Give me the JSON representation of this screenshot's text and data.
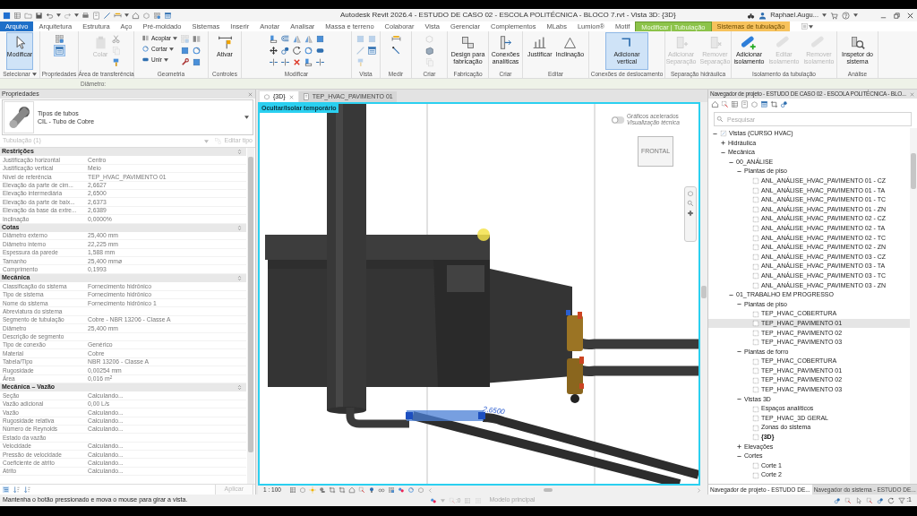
{
  "window": {
    "title": "Autodesk Revit 2026.4 - ESTUDO DE CASO 02 - ESCOLA POLITÉCNICA - BLOCO 7.rvt - Vista 3D: {3D}",
    "user": "Raphael.Augu..."
  },
  "ribbon_tabs": [
    {
      "label": "Arquivo",
      "kind": "file",
      "selected": false
    },
    {
      "label": "Arquitetura",
      "kind": "normal",
      "selected": false
    },
    {
      "label": "Estrutura",
      "kind": "normal",
      "selected": false
    },
    {
      "label": "Aço",
      "kind": "normal",
      "selected": false
    },
    {
      "label": "Pré-moldado",
      "kind": "normal",
      "selected": false
    },
    {
      "label": "Sistemas",
      "kind": "normal",
      "selected": false
    },
    {
      "label": "Inserir",
      "kind": "normal",
      "selected": false
    },
    {
      "label": "Anotar",
      "kind": "normal",
      "selected": false
    },
    {
      "label": "Analisar",
      "kind": "normal",
      "selected": false
    },
    {
      "label": "Massa e terreno",
      "kind": "normal",
      "selected": false
    },
    {
      "label": "Colaborar",
      "kind": "normal",
      "selected": false
    },
    {
      "label": "Vista",
      "kind": "normal",
      "selected": false
    },
    {
      "label": "Gerenciar",
      "kind": "normal",
      "selected": false
    },
    {
      "label": "Complementos",
      "kind": "normal",
      "selected": false
    },
    {
      "label": "MLabs",
      "kind": "normal",
      "selected": false
    },
    {
      "label": "Lumion®",
      "kind": "normal",
      "selected": false
    },
    {
      "label": "Motif",
      "kind": "normal",
      "selected": false
    },
    {
      "label": "Modificar | Tubulação",
      "kind": "contextual",
      "color": "#8cc34a",
      "selected": true
    },
    {
      "label": "Sistemas de tubulação",
      "kind": "contextual",
      "color": "#f7c25c",
      "selected": false
    }
  ],
  "ribbon_panels": [
    {
      "label": "Selecionar",
      "dropdown": true,
      "tools": [
        {
          "kind": "large",
          "label": "Modificar",
          "selected": true,
          "disabled": false
        }
      ]
    },
    {
      "label": "Propriedades",
      "dropdown": false,
      "tools": [
        {
          "kind": "icon",
          "selected": false,
          "disabled": false
        },
        {
          "kind": "icon",
          "selected": true,
          "disabled": false
        }
      ]
    },
    {
      "label": "Área de transferência",
      "dropdown": false,
      "tools": [
        {
          "kind": "large",
          "label": "Colar",
          "selected": false,
          "disabled": true
        },
        {
          "kind": "icon",
          "selected": false,
          "disabled": false
        },
        {
          "kind": "icon",
          "selected": false,
          "disabled": true
        },
        {
          "kind": "icon",
          "selected": false,
          "disabled": false
        }
      ]
    },
    {
      "label": "Geometria",
      "dropdown": false,
      "tools": [
        {
          "kind": "small",
          "label": "Acoplar",
          "dropdown": true,
          "selected": false,
          "disabled": false
        },
        {
          "kind": "small",
          "label": "Cortar",
          "dropdown": true,
          "selected": false,
          "disabled": false
        },
        {
          "kind": "small",
          "label": "Unir",
          "dropdown": true,
          "selected": false,
          "disabled": false
        },
        {
          "kind": "icon",
          "selected": false,
          "disabled": true
        },
        {
          "kind": "icon",
          "selected": false,
          "disabled": false
        },
        {
          "kind": "icon",
          "selected": false,
          "disabled": false
        },
        {
          "kind": "icon",
          "selected": false,
          "disabled": false
        },
        {
          "kind": "icon",
          "selected": false,
          "disabled": false
        },
        {
          "kind": "icon",
          "selected": false,
          "disabled": false
        }
      ]
    },
    {
      "label": "Controles",
      "dropdown": false,
      "tools": [
        {
          "kind": "large",
          "label": "Ativar",
          "selected": false,
          "disabled": false
        }
      ]
    },
    {
      "label": "Modificar",
      "dropdown": false,
      "tools": [
        {
          "kind": "icon",
          "selected": false,
          "disabled": false
        },
        {
          "kind": "icon",
          "selected": false,
          "disabled": false
        },
        {
          "kind": "icon",
          "selected": false,
          "disabled": false
        },
        {
          "kind": "icon",
          "selected": false,
          "disabled": false
        },
        {
          "kind": "icon",
          "selected": false,
          "disabled": false
        },
        {
          "kind": "icon",
          "selected": false,
          "disabled": false
        },
        {
          "kind": "icon",
          "selected": false,
          "disabled": false
        },
        {
          "kind": "icon",
          "selected": false,
          "disabled": false
        },
        {
          "kind": "icon",
          "selected": false,
          "disabled": false
        },
        {
          "kind": "icon",
          "selected": false,
          "disabled": false
        },
        {
          "kind": "icon",
          "selected": false,
          "disabled": false
        },
        {
          "kind": "icon",
          "selected": false,
          "disabled": false
        },
        {
          "kind": "icon",
          "selected": false,
          "disabled": false
        },
        {
          "kind": "icon",
          "selected": false,
          "disabled": false
        },
        {
          "kind": "icon",
          "selected": false,
          "disabled": false
        }
      ]
    },
    {
      "label": "Vista",
      "dropdown": false,
      "tools": [
        {
          "kind": "icon",
          "selected": false,
          "disabled": true
        },
        {
          "kind": "icon",
          "selected": false,
          "disabled": true
        },
        {
          "kind": "icon",
          "selected": false,
          "disabled": true
        },
        {
          "kind": "icon",
          "selected": false,
          "disabled": true
        },
        {
          "kind": "icon",
          "selected": false,
          "disabled": false
        }
      ]
    },
    {
      "label": "Medir",
      "dropdown": false,
      "tools": [
        {
          "kind": "icon",
          "selected": false,
          "disabled": false
        },
        {
          "kind": "icon",
          "selected": false,
          "disabled": false
        }
      ]
    },
    {
      "label": "Criar",
      "dropdown": false,
      "tools": [
        {
          "kind": "icon",
          "selected": false,
          "disabled": true
        },
        {
          "kind": "icon",
          "selected": false,
          "disabled": false
        },
        {
          "kind": "icon",
          "selected": false,
          "disabled": true
        }
      ]
    },
    {
      "label": "Fabricação",
      "dropdown": false,
      "tools": [
        {
          "kind": "large",
          "label": "Design para fabricação",
          "selected": false,
          "disabled": false
        }
      ]
    },
    {
      "label": "Criar",
      "dropdown": false,
      "tools": [
        {
          "kind": "large",
          "label": "Conexões analíticas",
          "selected": false,
          "disabled": false
        }
      ]
    },
    {
      "label": "Editar",
      "dropdown": false,
      "tools": [
        {
          "kind": "large",
          "label": "Justificar",
          "selected": false,
          "disabled": false
        },
        {
          "kind": "large",
          "label": "Inclinação",
          "selected": false,
          "disabled": false
        }
      ]
    },
    {
      "label": "Conexões de deslocamento",
      "dropdown": false,
      "tools": [
        {
          "kind": "large",
          "label": "Adicionar vertical",
          "selected": true,
          "disabled": false
        }
      ]
    },
    {
      "label": "Separação hidráulica",
      "dropdown": false,
      "tools": [
        {
          "kind": "large",
          "label": "Adicionar Separação",
          "selected": false,
          "disabled": true
        },
        {
          "kind": "large",
          "label": "Remover Separação",
          "selected": false,
          "disabled": true
        }
      ]
    },
    {
      "label": "Isolamento da tubulação",
      "dropdown": false,
      "tools": [
        {
          "kind": "large",
          "label": "Adicionar isolamento",
          "selected": false,
          "disabled": false
        },
        {
          "kind": "large",
          "label": "Editar isolamento",
          "selected": false,
          "disabled": true
        },
        {
          "kind": "large",
          "label": "Remover isolamento",
          "selected": false,
          "disabled": true
        }
      ]
    },
    {
      "label": "Análise",
      "dropdown": false,
      "tools": [
        {
          "kind": "large",
          "label": "Inspetor do sistema",
          "selected": false,
          "disabled": false
        }
      ]
    }
  ],
  "options_bar": {
    "label": "Diâmetro:"
  },
  "properties": {
    "title": "Propriedades",
    "type_family": "Tipos de tubos",
    "type_name": "CIL - Tubo de Cobre",
    "filter": {
      "label": "Tubulação (1)",
      "disabled": true
    },
    "edit_type": {
      "label": "Editar tipo",
      "disabled": true
    },
    "groups": [
      {
        "name": "Restrições",
        "rows": [
          {
            "label": "Justificação horizontal",
            "value": "Centro"
          },
          {
            "label": "Justificação vertical",
            "value": "Meio"
          },
          {
            "label": "Nível de referência",
            "value": "TEP_HVAC_PAVIMENTO 01"
          },
          {
            "label": "Elevação da parte de cim...",
            "value": "2,6627"
          },
          {
            "label": "Elevação intermediária",
            "value": "2,6500"
          },
          {
            "label": "Elevação da parte de baix...",
            "value": "2,6373"
          },
          {
            "label": "Elevação da base da extre...",
            "value": "2,6389"
          },
          {
            "label": "Inclinação",
            "value": "0,0000%"
          }
        ]
      },
      {
        "name": "Cotas",
        "rows": [
          {
            "label": "Diâmetro externo",
            "value": "25,400 mm"
          },
          {
            "label": "Diâmetro interno",
            "value": "22,225 mm"
          },
          {
            "label": "Espessura da parede",
            "value": "1,588 mm"
          },
          {
            "label": "Tamanho",
            "value": "25,400 mmø"
          },
          {
            "label": "Comprimento",
            "value": "0,1993"
          }
        ]
      },
      {
        "name": "Mecânica",
        "rows": [
          {
            "label": "Classificação do sistema",
            "value": "Fornecimento hidrônico"
          },
          {
            "label": "Tipo de sistema",
            "value": "Fornecimento hidrônico"
          },
          {
            "label": "Nome do sistema",
            "value": "Fornecimento hidrônico 1"
          },
          {
            "label": "Abreviatura do sistema"
          },
          {
            "label": "Segmento de tubulação",
            "value": "Cobre - NBR 13206 - Classe A"
          },
          {
            "label": "Diâmetro",
            "value": "25,400 mm"
          },
          {
            "label": "Descrição de segmento"
          },
          {
            "label": "Tipo de conexão",
            "value": "Genérico"
          },
          {
            "label": "Material",
            "value": "Cobre"
          },
          {
            "label": "Tabela/Tipo",
            "value": "NBR 13206 - Classe A"
          },
          {
            "label": "Rugosidade",
            "value": "0,00254 mm"
          },
          {
            "label": "Área",
            "value": "0,016 m$^{2}$"
          }
        ]
      },
      {
        "name": "Mecânica – Vazão",
        "rows": [
          {
            "label": "Seção",
            "value": "Calculando..."
          },
          {
            "label": "Vazão adicional",
            "value": "0,00 L/s"
          },
          {
            "label": "Vazão",
            "value": "Calculando..."
          },
          {
            "label": "Rugosidade relativa",
            "value": "Calculando..."
          },
          {
            "label": "Número de Reynolds",
            "value": "Calculando..."
          },
          {
            "label": "Estado da vazão"
          },
          {
            "label": "Velocidade",
            "value": "Calculando..."
          },
          {
            "label": "Pressão de velocidade",
            "value": "Calculando..."
          },
          {
            "label": "Coeficiente de atrito",
            "value": "Calculando..."
          },
          {
            "label": "Atrito",
            "value": "Calculando..."
          }
        ]
      }
    ],
    "apply": {
      "label": "Aplicar",
      "disabled": true
    }
  },
  "view_tabs": [
    {
      "label": "{3D}",
      "selected": true
    },
    {
      "label": "TEP_HVAC_PAVIMENTO 01",
      "selected": false
    }
  ],
  "viewport": {
    "banner": "Ocultar/Isolar temporário",
    "graphics_toggle": {
      "label": "Gráficos acelerados",
      "sublabel": "Visualização técnica",
      "on": false
    },
    "viewcube_face": "FRONTAL",
    "dimension": "2,6500"
  },
  "view_control_bar": {
    "scale": "1 : 100"
  },
  "project_browser": {
    "title": "Navegador de projeto - ESTUDO DE CASO 02 - ESCOLA POLITÉCNICA - BLO...",
    "search": {
      "placeholder": "Pesquisar"
    },
    "tree": [
      {
        "label": "Vistas (CURSO HVAC)",
        "kind": "root",
        "expanded": true,
        "children": [
          {
            "label": "Hidráulica",
            "kind": "folder",
            "expanded": false
          },
          {
            "label": "Mecânica",
            "kind": "folder",
            "expanded": true,
            "children": [
              {
                "label": "00_ANÁLISE",
                "kind": "folder",
                "expanded": true,
                "children": [
                  {
                    "label": "Plantas de piso",
                    "kind": "folder",
                    "expanded": true,
                    "children": [
                      {
                        "label": "ANL_ANÁLISE_HVAC_PAVIMENTO 01 - CZ",
                        "kind": "view",
                        "selected": false
                      },
                      {
                        "label": "ANL_ANÁLISE_HVAC_PAVIMENTO 01 - TA",
                        "kind": "view",
                        "selected": false
                      },
                      {
                        "label": "ANL_ANÁLISE_HVAC_PAVIMENTO 01 - TC",
                        "kind": "view",
                        "selected": false
                      },
                      {
                        "label": "ANL_ANÁLISE_HVAC_PAVIMENTO 01 - ZN",
                        "kind": "view",
                        "selected": false
                      },
                      {
                        "label": "ANL_ANÁLISE_HVAC_PAVIMENTO 02 - CZ",
                        "kind": "view",
                        "selected": false
                      },
                      {
                        "label": "ANL_ANÁLISE_HVAC_PAVIMENTO 02 - TA",
                        "kind": "view",
                        "selected": false
                      },
                      {
                        "label": "ANL_ANÁLISE_HVAC_PAVIMENTO 02 - TC",
                        "kind": "view",
                        "selected": false
                      },
                      {
                        "label": "ANL_ANÁLISE_HVAC_PAVIMENTO 02 - ZN",
                        "kind": "view",
                        "selected": false
                      },
                      {
                        "label": "ANL_ANÁLISE_HVAC_PAVIMENTO 03 - CZ",
                        "kind": "view",
                        "selected": false
                      },
                      {
                        "label": "ANL_ANÁLISE_HVAC_PAVIMENTO 03 - TA",
                        "kind": "view",
                        "selected": false
                      },
                      {
                        "label": "ANL_ANÁLISE_HVAC_PAVIMENTO 03 - TC",
                        "kind": "view",
                        "selected": false
                      },
                      {
                        "label": "ANL_ANÁLISE_HVAC_PAVIMENTO 03 - ZN",
                        "kind": "view",
                        "selected": false
                      }
                    ]
                  }
                ]
              },
              {
                "label": "01_TRABALHO EM PROGRESSO",
                "kind": "folder",
                "expanded": true,
                "children": [
                  {
                    "label": "Plantas de piso",
                    "kind": "folder",
                    "expanded": true,
                    "children": [
                      {
                        "label": "TEP_HVAC_COBERTURA",
                        "kind": "view",
                        "selected": false
                      },
                      {
                        "label": "TEP_HVAC_PAVIMENTO 01",
                        "kind": "view",
                        "selected": true
                      },
                      {
                        "label": "TEP_HVAC_PAVIMENTO 02",
                        "kind": "view",
                        "selected": false
                      },
                      {
                        "label": "TEP_HVAC_PAVIMENTO 03",
                        "kind": "view",
                        "selected": false
                      }
                    ]
                  },
                  {
                    "label": "Plantas de forro",
                    "kind": "folder",
                    "expanded": true,
                    "children": [
                      {
                        "label": "TEP_HVAC_COBERTURA",
                        "kind": "view",
                        "selected": false
                      },
                      {
                        "label": "TEP_HVAC_PAVIMENTO 01",
                        "kind": "view",
                        "selected": false
                      },
                      {
                        "label": "TEP_HVAC_PAVIMENTO 02",
                        "kind": "view",
                        "selected": false
                      },
                      {
                        "label": "TEP_HVAC_PAVIMENTO 03",
                        "kind": "view",
                        "selected": false
                      }
                    ]
                  },
                  {
                    "label": "Vistas 3D",
                    "kind": "folder",
                    "expanded": true,
                    "children": [
                      {
                        "label": "Espaços analíticos",
                        "kind": "view",
                        "selected": false
                      },
                      {
                        "label": "TEP_HVAC_3D GERAL",
                        "kind": "view",
                        "selected": false
                      },
                      {
                        "label": "Zonas do sistema",
                        "kind": "view",
                        "selected": false
                      },
                      {
                        "label": "{3D}",
                        "kind": "view",
                        "selected": false,
                        "current": true
                      }
                    ]
                  },
                  {
                    "label": "Elevações",
                    "kind": "folder",
                    "expanded": false
                  },
                  {
                    "label": "Cortes",
                    "kind": "folder",
                    "expanded": true,
                    "children": [
                      {
                        "label": "Corte 1",
                        "kind": "view",
                        "selected": false
                      },
                      {
                        "label": "Corte 2",
                        "kind": "view",
                        "selected": false
                      }
                    ]
                  }
                ]
              }
            ]
          }
        ]
      }
    ],
    "bottom_tabs": [
      {
        "label": "Navegador de projeto - ESTUDO DE...",
        "selected": true
      },
      {
        "label": "Navegador do sistema - ESTUDO DE...",
        "selected": false
      }
    ]
  },
  "status_bar": {
    "hint": "Mantenha o botão pressionado e mova o mouse para girar a vista.",
    "editable_count": ":0",
    "model": "Modelo principal",
    "filter_count": ":1"
  }
}
